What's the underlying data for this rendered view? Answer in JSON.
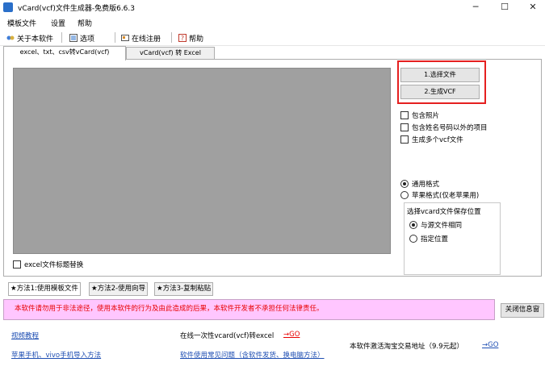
{
  "window": {
    "title": "vCard(vcf)文件生成器-免费版6.6.3",
    "minimize": "─",
    "maximize": "☐",
    "close": "✕"
  },
  "menu": [
    "模板文件",
    "设置",
    "帮助"
  ],
  "toolbar": {
    "about": "关于本软件",
    "options": "选项",
    "register": "在线注册",
    "help": "帮助"
  },
  "tabs": {
    "tab1": "excel、txt、csv转vCard(vcf)",
    "tab2": "vCard(vcf) 转 Excel"
  },
  "buttons": {
    "select_file": "1.选择文件",
    "generate_vcf": "2.生成VCF"
  },
  "options": {
    "include_photo": "包含照片",
    "include_extra": "包含姓名号码以外的项目",
    "multi_vcf": "生成多个vcf文件"
  },
  "format": {
    "general": "通用格式",
    "apple": "苹果格式(仅老苹果用)"
  },
  "save_location": {
    "title": "选择vcard文件保存位置",
    "same_as_source": "与源文件相同",
    "specify": "指定位置"
  },
  "header_replace": "excel文件标题替换",
  "method_tabs": {
    "m1": "★方法1:使用模板文件",
    "m2": "★方法2-使用向导",
    "m3": "★方法3-复制粘贴"
  },
  "notice": "本软件请勿用于非法途径，使用本软件的行为及由此造成的后果，本软件开发者不承担任何法律责任。",
  "close_info": "关闭信息窗",
  "footer": {
    "video": "视频教程",
    "import_method": "苹果手机、vivo手机导入方法",
    "online_convert": "在线一次性vcard(vcf)转excel",
    "online_go": "→GO",
    "faq": "软件使用常见问题（含软件发货、换电脑方法）",
    "activation": "本软件激活淘宝交易地址（9.9元起）",
    "activation_go": "→GO"
  },
  "colors": {
    "notice_bg": "#ffc6ff",
    "notice_text": "#e80000",
    "highlight_border": "#e52020",
    "link": "#1f4fb3"
  }
}
